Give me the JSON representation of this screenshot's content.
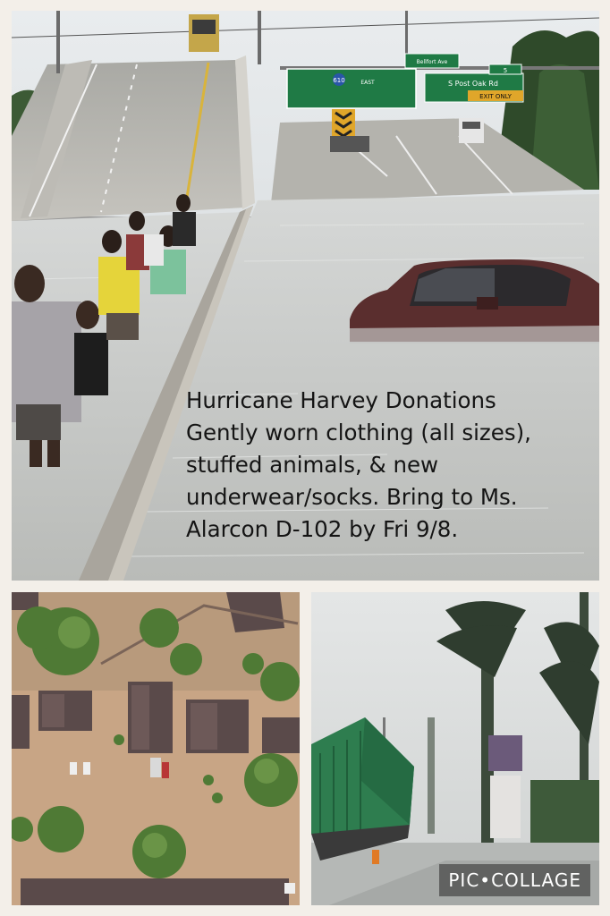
{
  "collage": {
    "caption_lines": [
      "Hurricane Harvey Donations",
      "Gently worn clothing (all sizes),",
      "stuffed animals, & new",
      "underwear/socks. Bring to Ms.",
      "Alarcon D-102 by Fri 9/8."
    ],
    "watermark": "PIC•COLLAGE",
    "signs": {
      "sign_610_route": "610",
      "sign_610_dir": "EAST",
      "sign_bellfort": "Bellfort Ave",
      "sign_spost": "S Post Oak Rd",
      "sign_exit": "EXIT ONLY",
      "sign_exit_num": "5"
    }
  },
  "colors": {
    "background": "#f3efe9",
    "floodwater": "#c9ccca",
    "highway_sign": "#1f7a45",
    "container": "#2e7d4f"
  }
}
